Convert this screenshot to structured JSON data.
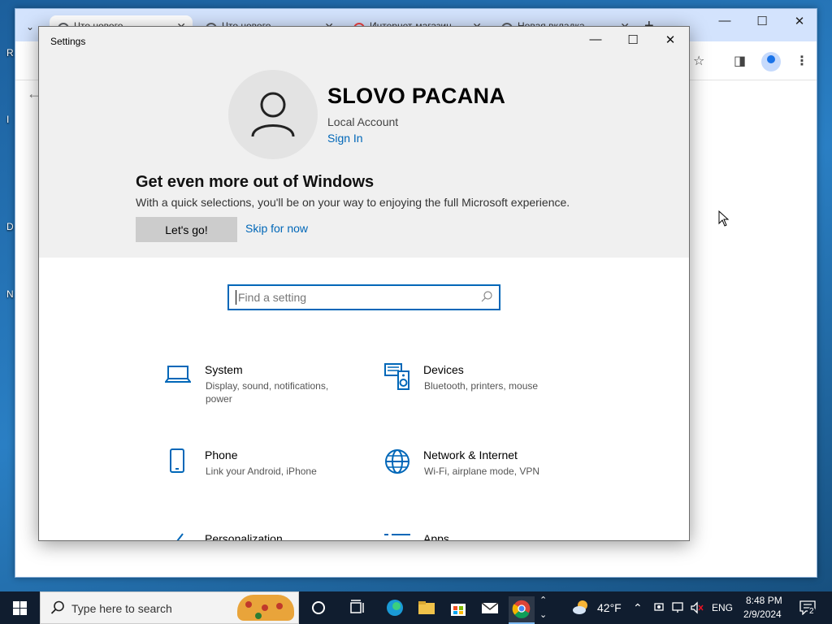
{
  "desktop": {
    "frags": [
      "R",
      "I",
      "D",
      "N"
    ]
  },
  "chrome": {
    "tabs": [
      {
        "label": "Что нового"
      },
      {
        "label": "Что нового"
      },
      {
        "label": "Интернет-магазин"
      },
      {
        "label": "Новая вкладка"
      }
    ],
    "tab_close": "✕",
    "new_tab": "+",
    "list_btn": "⌄",
    "minimize": "—",
    "maximize": "☐",
    "close": "✕",
    "back": "←",
    "bookmark": "☆",
    "sidepanel": "◨",
    "menu": "⋮"
  },
  "settings": {
    "title": "Settings",
    "minimize": "—",
    "maximize": "☐",
    "close": "✕",
    "account": {
      "name": "SLOVO PACANA",
      "type": "Local Account",
      "sign_in": "Sign In"
    },
    "promo": {
      "title": "Get even more out of Windows",
      "text": "With a quick selections, you'll be on your way to enjoying the full Microsoft experience.",
      "primary": "Let's go!",
      "secondary": "Skip for now"
    },
    "search": {
      "placeholder": "Find a setting"
    },
    "categories": [
      {
        "name": "System",
        "desc": "Display, sound, notifications, power"
      },
      {
        "name": "Devices",
        "desc": "Bluetooth, printers, mouse"
      },
      {
        "name": "Phone",
        "desc": "Link your Android, iPhone"
      },
      {
        "name": "Network & Internet",
        "desc": "Wi-Fi, airplane mode, VPN"
      },
      {
        "name": "Personalization",
        "desc": ""
      },
      {
        "name": "Apps",
        "desc": ""
      }
    ]
  },
  "taskbar": {
    "search_label": "Type here to search",
    "weather": "42°F",
    "lang": "ENG",
    "time": "8:48 PM",
    "date": "2/9/2024",
    "notifications": "2",
    "tray_up": "⌃"
  }
}
